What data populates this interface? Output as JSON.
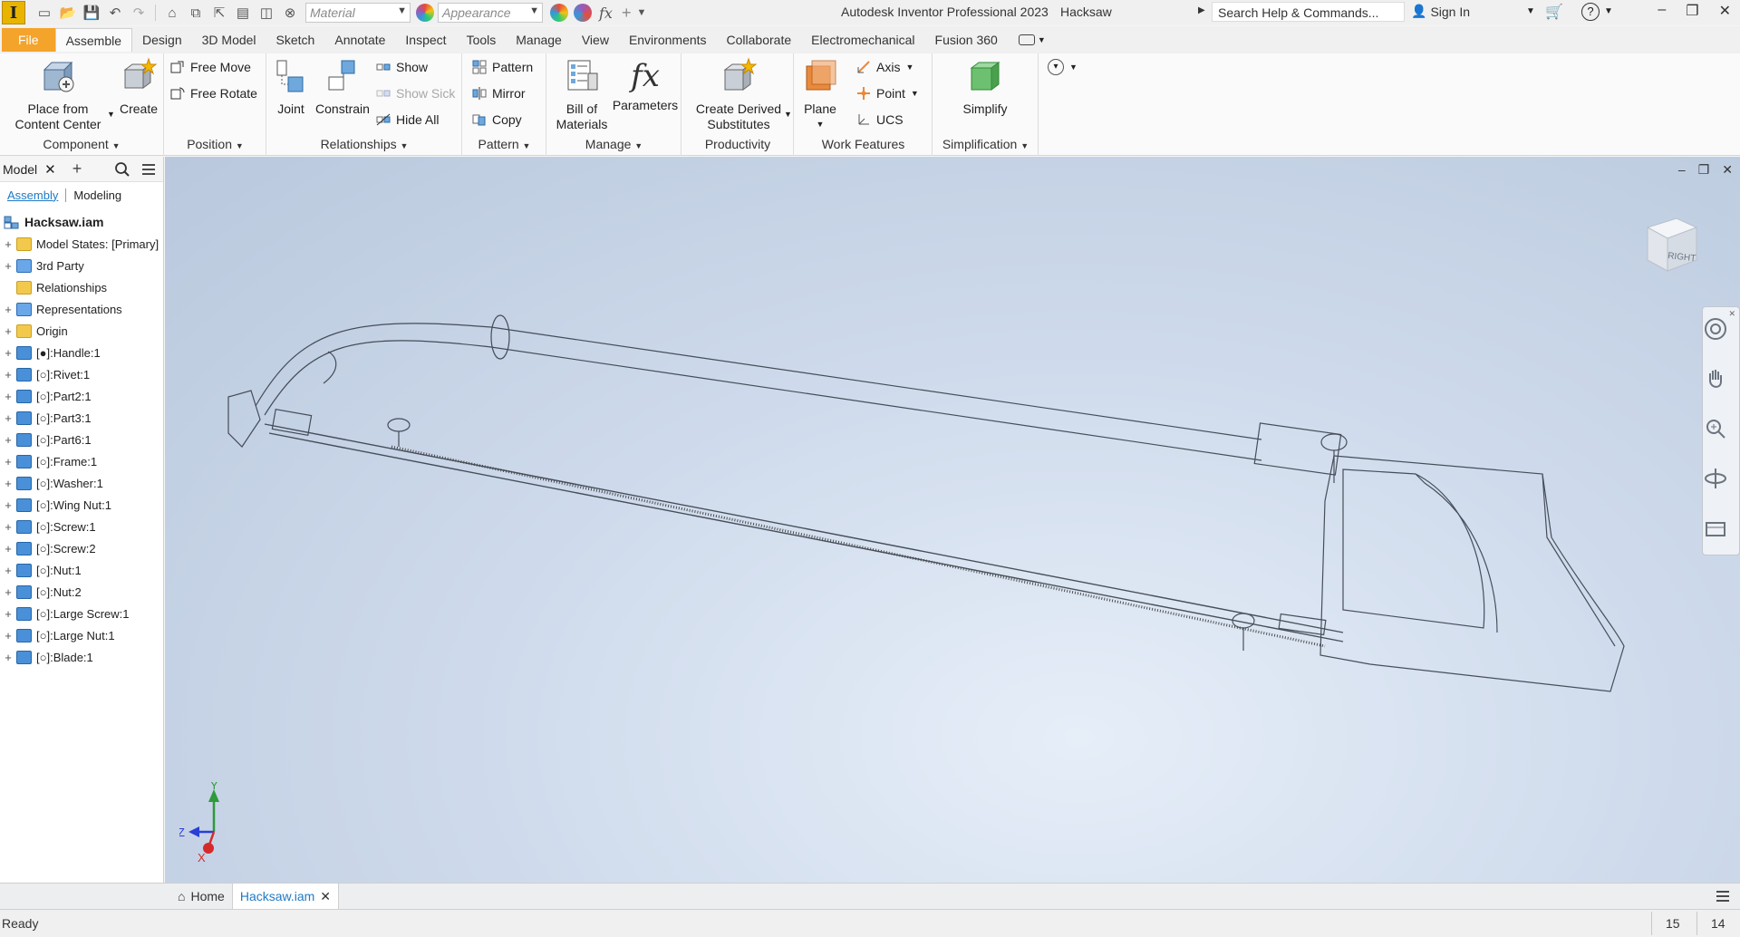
{
  "titlebar": {
    "app_letter": "I",
    "app_title": "Autodesk Inventor Professional 2023",
    "doc_title": "Hacksaw",
    "material_placeholder": "Material",
    "appearance_placeholder": "Appearance",
    "search": "Search Help & Commands...",
    "sign_in": "Sign In",
    "fx_label": "fx"
  },
  "tabs": [
    "File",
    "Assemble",
    "Design",
    "3D Model",
    "Sketch",
    "Annotate",
    "Inspect",
    "Tools",
    "Manage",
    "View",
    "Environments",
    "Collaborate",
    "Electromechanical",
    "Fusion 360"
  ],
  "active_tab": "Assemble",
  "ribbon": {
    "component": {
      "title": "Component",
      "place_line1": "Place from",
      "place_line2": "Content Center",
      "create": "Create"
    },
    "position": {
      "title": "Position",
      "free_move": "Free Move",
      "free_rotate": "Free Rotate"
    },
    "relationships": {
      "title": "Relationships",
      "joint": "Joint",
      "constrain": "Constrain",
      "show": "Show",
      "show_sick": "Show Sick",
      "hide_all": "Hide All"
    },
    "pattern": {
      "title": "Pattern",
      "pattern": "Pattern",
      "mirror": "Mirror",
      "copy": "Copy"
    },
    "manage": {
      "title": "Manage",
      "bom_line1": "Bill of",
      "bom_line2": "Materials",
      "parameters": "Parameters",
      "fx_glyph": "fx"
    },
    "productivity": {
      "title": "Productivity",
      "cds_line1": "Create Derived",
      "cds_line2": "Substitutes"
    },
    "work_features": {
      "title": "Work Features",
      "plane": "Plane",
      "axis": "Axis",
      "point": "Point",
      "ucs": "UCS"
    },
    "simplification": {
      "title": "Simplification",
      "simplify": "Simplify"
    }
  },
  "browser": {
    "tab_label": "Model",
    "subtab_assembly": "Assembly",
    "subtab_modeling": "Modeling",
    "root": "Hacksaw.iam",
    "nodes": [
      {
        "label": "Model States: [Primary]",
        "icon": "folder-icon",
        "expand": "+"
      },
      {
        "label": "3rd Party",
        "icon": "third-party-icon",
        "expand": "+"
      },
      {
        "label": "Relationships",
        "icon": "folder-icon",
        "expand": ""
      },
      {
        "label": "Representations",
        "icon": "representations-icon",
        "expand": "+"
      },
      {
        "label": "Origin",
        "icon": "folder-icon",
        "expand": "+"
      },
      {
        "label": "[●]:Handle:1",
        "icon": "part-icon",
        "expand": "+"
      },
      {
        "label": "[○]:Rivet:1",
        "icon": "part-icon",
        "expand": "+"
      },
      {
        "label": "[○]:Part2:1",
        "icon": "part-icon",
        "expand": "+"
      },
      {
        "label": "[○]:Part3:1",
        "icon": "part-icon",
        "expand": "+"
      },
      {
        "label": "[○]:Part6:1",
        "icon": "part-icon",
        "expand": "+"
      },
      {
        "label": "[○]:Frame:1",
        "icon": "part-icon",
        "expand": "+"
      },
      {
        "label": "[○]:Washer:1",
        "icon": "part-icon",
        "expand": "+"
      },
      {
        "label": "[○]:Wing Nut:1",
        "icon": "part-icon",
        "expand": "+"
      },
      {
        "label": "[○]:Screw:1",
        "icon": "part-icon",
        "expand": "+"
      },
      {
        "label": "[○]:Screw:2",
        "icon": "part-icon",
        "expand": "+"
      },
      {
        "label": "[○]:Nut:1",
        "icon": "part-icon",
        "expand": "+"
      },
      {
        "label": "[○]:Nut:2",
        "icon": "part-icon",
        "expand": "+"
      },
      {
        "label": "[○]:Large Screw:1",
        "icon": "part-icon",
        "expand": "+"
      },
      {
        "label": "[○]:Large Nut:1",
        "icon": "part-icon",
        "expand": "+"
      },
      {
        "label": "[○]:Blade:1",
        "icon": "part-icon",
        "expand": "+"
      }
    ]
  },
  "viewport": {
    "viewcube_face": "RIGHT",
    "triad_y": "Y",
    "triad_z": "Z",
    "triad_x": "X"
  },
  "doctabs": {
    "home": "Home",
    "active_doc": "Hacksaw.iam"
  },
  "status": {
    "text": "Ready",
    "n1": "15",
    "n2": "14"
  },
  "colors": {
    "file_tab": "#f4a32b",
    "accent_blue": "#1f7ac4",
    "viewport_light": "#e6eef8",
    "viewport_dark": "#b9c8dd"
  }
}
